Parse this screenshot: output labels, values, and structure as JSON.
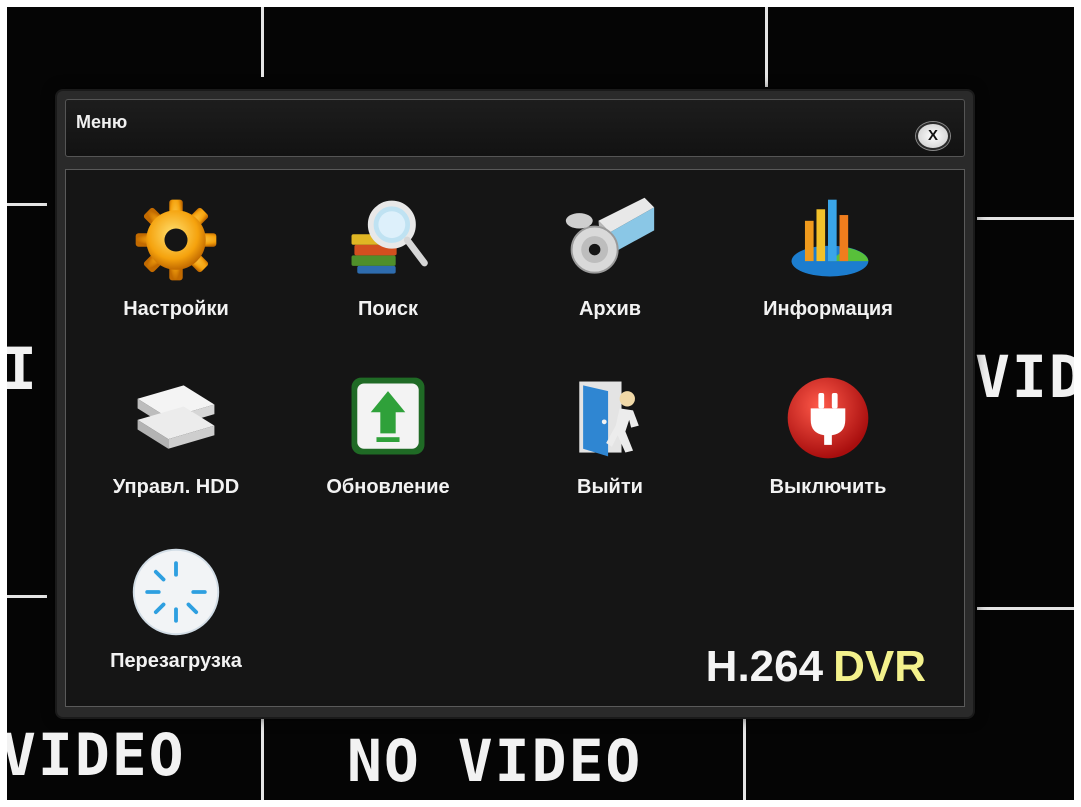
{
  "background": {
    "no_video_left": "VIDEO",
    "no_video_center": "NO VIDEO",
    "no_video_side_left": "VI",
    "no_video_side_right": "VID"
  },
  "menu": {
    "title": "Меню",
    "close_label": "X",
    "items": [
      {
        "label": "Настройки",
        "icon": "gear-icon"
      },
      {
        "label": "Поиск",
        "icon": "search-books-icon"
      },
      {
        "label": "Архив",
        "icon": "archive-disc-icon"
      },
      {
        "label": "Информация",
        "icon": "bar-chart-icon"
      },
      {
        "label": "Управл. HDD",
        "icon": "hdd-icon"
      },
      {
        "label": "Обновление",
        "icon": "upgrade-arrow-icon"
      },
      {
        "label": "Выйти",
        "icon": "exit-door-icon"
      },
      {
        "label": "Выключить",
        "icon": "power-plug-icon"
      },
      {
        "label": "Перезагрузка",
        "icon": "reboot-spinner-icon"
      }
    ],
    "brand": {
      "codec": "H.264",
      "product": "DVR"
    }
  },
  "colors": {
    "accent_yellow": "#f3f18c",
    "panel_bg": "#151515",
    "power_red": "#d31d1d",
    "upgrade_green": "#2f9b3a"
  }
}
